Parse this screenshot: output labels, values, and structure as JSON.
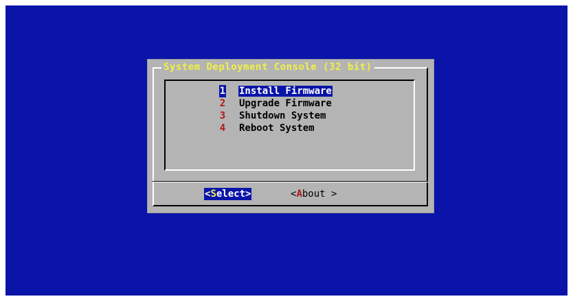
{
  "dialog": {
    "title": "System Deployment Console (32 bit)"
  },
  "menu": {
    "items": [
      {
        "key": "1",
        "label": "Install Firmware",
        "selected": true
      },
      {
        "key": "2",
        "label": "Upgrade Firmware",
        "selected": false
      },
      {
        "key": "3",
        "label": "Shutdown System",
        "selected": false
      },
      {
        "key": "4",
        "label": "Reboot System",
        "selected": false
      }
    ]
  },
  "buttons": {
    "select": {
      "open": "<",
      "hot": "S",
      "rest": "elect",
      "close": ">"
    },
    "about": {
      "open": "<",
      "hot": "A",
      "rest": "bout",
      "close": " >"
    }
  },
  "colors": {
    "screen_background": "#0a14a8",
    "dialog_background": "#b4b4b4",
    "title_text": "#f0f046",
    "hotkey_text": "#b01818",
    "selection_background": "#0a14a8"
  }
}
